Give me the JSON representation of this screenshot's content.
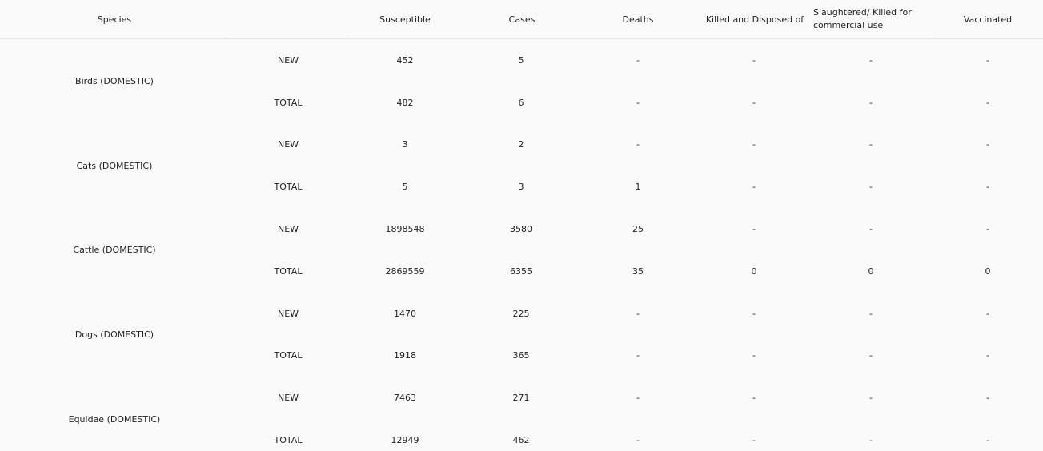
{
  "headers": {
    "species": "Species",
    "susceptible": "Susceptible",
    "cases": "Cases",
    "deaths": "Deaths",
    "killed": "Killed and Disposed of",
    "slaughtered_line1": "Slaughtered/ Killed for",
    "slaughtered_line2": "commercial use",
    "vaccinated": "Vaccinated"
  },
  "groups": [
    {
      "species": "Birds (DOMESTIC)",
      "rows": [
        {
          "type": "NEW",
          "susceptible": "452",
          "cases": "5",
          "deaths": "-",
          "killed": "-",
          "slaughtered": "-",
          "vaccinated": "-"
        },
        {
          "type": "TOTAL",
          "susceptible": "482",
          "cases": "6",
          "deaths": "-",
          "killed": "-",
          "slaughtered": "-",
          "vaccinated": "-"
        }
      ]
    },
    {
      "species": "Cats (DOMESTIC)",
      "rows": [
        {
          "type": "NEW",
          "susceptible": "3",
          "cases": "2",
          "deaths": "-",
          "killed": "-",
          "slaughtered": "-",
          "vaccinated": "-"
        },
        {
          "type": "TOTAL",
          "susceptible": "5",
          "cases": "3",
          "deaths": "1",
          "killed": "-",
          "slaughtered": "-",
          "vaccinated": "-"
        }
      ]
    },
    {
      "species": "Cattle (DOMESTIC)",
      "rows": [
        {
          "type": "NEW",
          "susceptible": "1898548",
          "cases": "3580",
          "deaths": "25",
          "killed": "-",
          "slaughtered": "-",
          "vaccinated": "-"
        },
        {
          "type": "TOTAL",
          "susceptible": "2869559",
          "cases": "6355",
          "deaths": "35",
          "killed": "0",
          "slaughtered": "0",
          "vaccinated": "0"
        }
      ]
    },
    {
      "species": "Dogs (DOMESTIC)",
      "rows": [
        {
          "type": "NEW",
          "susceptible": "1470",
          "cases": "225",
          "deaths": "-",
          "killed": "-",
          "slaughtered": "-",
          "vaccinated": "-"
        },
        {
          "type": "TOTAL",
          "susceptible": "1918",
          "cases": "365",
          "deaths": "-",
          "killed": "-",
          "slaughtered": "-",
          "vaccinated": "-"
        }
      ]
    },
    {
      "species": "Equidae (DOMESTIC)",
      "rows": [
        {
          "type": "NEW",
          "susceptible": "7463",
          "cases": "271",
          "deaths": "-",
          "killed": "-",
          "slaughtered": "-",
          "vaccinated": "-"
        },
        {
          "type": "TOTAL",
          "susceptible": "12949",
          "cases": "462",
          "deaths": "-",
          "killed": "-",
          "slaughtered": "-",
          "vaccinated": "-"
        }
      ]
    }
  ]
}
